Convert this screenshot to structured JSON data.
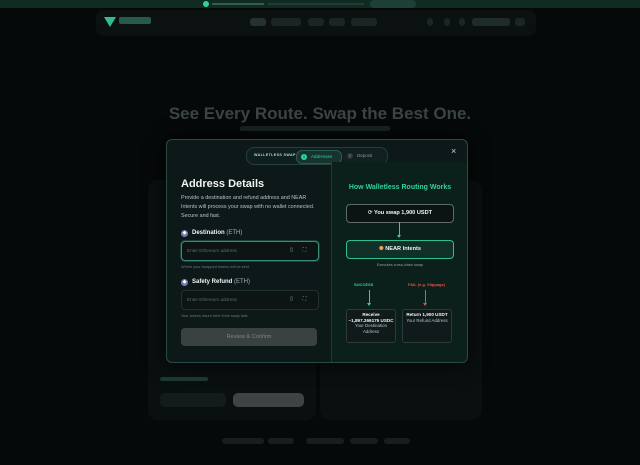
{
  "background": {
    "hero_title": "See Every Route. Swap the Best One."
  },
  "modal": {
    "stepper": {
      "brand": "WALLETLESS SWAP",
      "steps": [
        {
          "num": "1",
          "label": "Addresses"
        },
        {
          "num": "2",
          "label": "Deposit"
        }
      ]
    },
    "close_icon": "×",
    "title": "Address Details",
    "description": "Provide a destination and refund address and NEAR Intents will process your swap with no wallet connected. Secure and fast.",
    "destination": {
      "label": "Destination",
      "chain": "(ETH)",
      "placeholder": "Enter Ethereum address",
      "hint": "Where your swapped tokens will be sent"
    },
    "refund": {
      "label": "Safety Refund",
      "chain": "(ETH)",
      "placeholder": "Enter Ethereum address",
      "hint": "Your tokens return here if the swap fails"
    },
    "review_button": "Review & Confirm",
    "routing": {
      "title": "How Walletless Routing Works",
      "swap_text": "You swap 1,900 USDT",
      "near_text": "NEAR Intents",
      "executes": "Executes cross-chain swap",
      "success_label": "SUCCESS",
      "fail_label": "FAIL (e.g. Slippage)",
      "success_box": {
        "main": "Receive ~1,897.266175 USDC",
        "sub": "Your Destination Address"
      },
      "fail_box": {
        "main": "Return 1,900 USDT",
        "sub": "Your Refund Address"
      }
    }
  },
  "colors": {
    "accent": "#2fd39a",
    "fail": "#e0534a",
    "modal_bg": "#0d1818"
  }
}
